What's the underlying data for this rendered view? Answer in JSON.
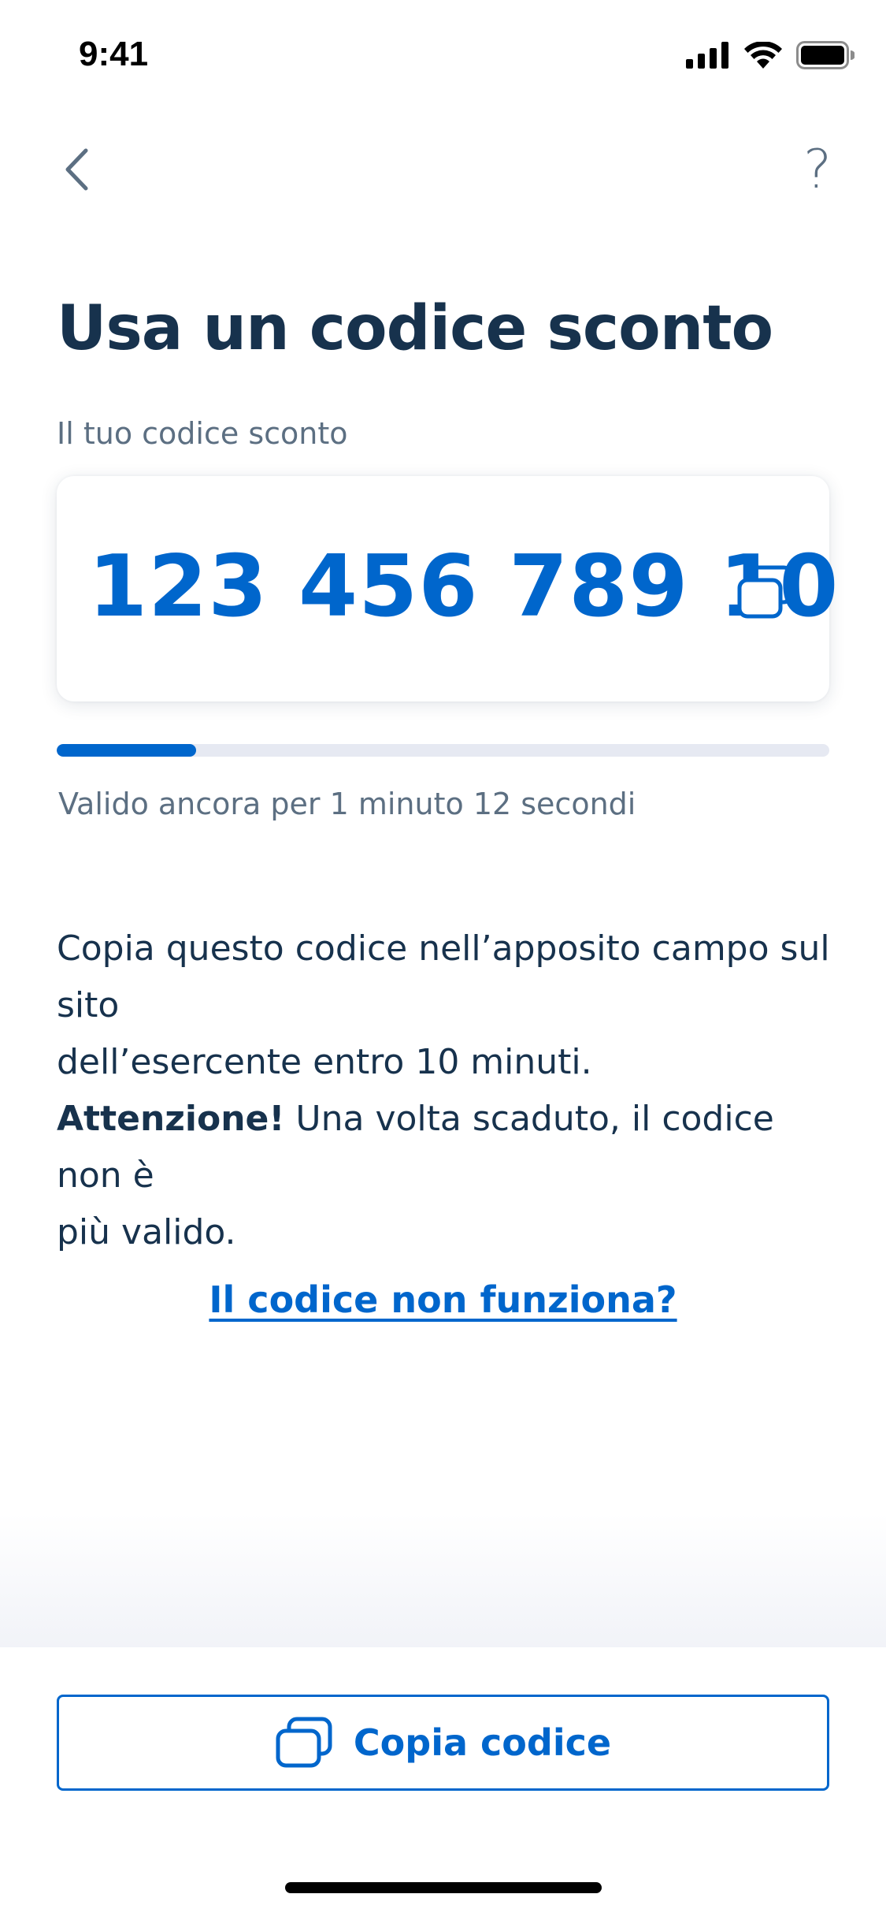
{
  "status_bar": {
    "time": "9:41"
  },
  "nav": {
    "help_label": "?"
  },
  "title": "Usa un codice sconto",
  "code": {
    "label": "Il tuo codice sconto",
    "value": "123 456 789 10"
  },
  "validity": {
    "progress_fraction": 0.18,
    "text": "Valido ancora per 1 minuto 12 secondi"
  },
  "instructions": {
    "line1": "Copia questo codice nell’apposito campo sul sito",
    "line2": "dell’esercente entro 10 minuti."
  },
  "warning": {
    "bold": "Attenzione!",
    "rest": " Una volta scaduto, il codice non è",
    "line2": "più valido."
  },
  "help_link": "Il codice non funziona?",
  "copy_button": {
    "label": "Copia codice"
  },
  "colors": {
    "primary": "#0066cc",
    "text_dark": "#17324d",
    "text_muted": "#5c6f82",
    "track": "#e6e9f2"
  },
  "icons": {
    "back": "chevron-left-icon",
    "help": "question-mark-icon",
    "copy": "copy-icon"
  }
}
